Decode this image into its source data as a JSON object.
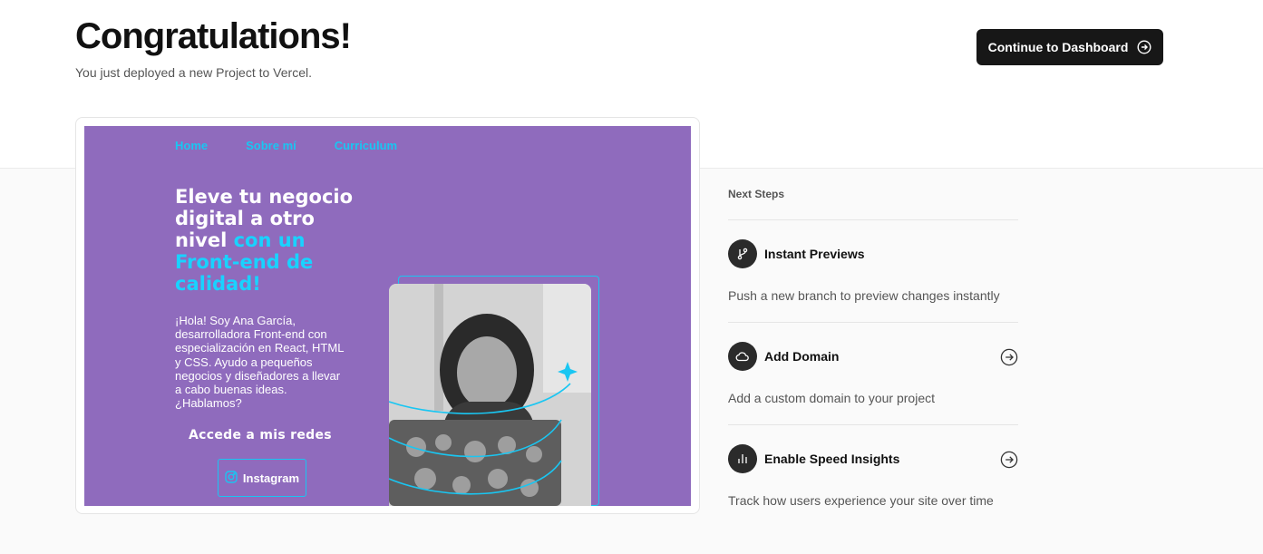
{
  "header": {
    "title": "Congratulations!",
    "subtitle": "You just deployed a new Project to Vercel.",
    "continue_label": "Continue to Dashboard"
  },
  "preview": {
    "nav": [
      "Home",
      "Sobre mí",
      "Curriculum"
    ],
    "headline_white": "Eleve tu negocio digital a otro nivel",
    "headline_accent": "con un Front-end de calidad!",
    "body": "¡Hola! Soy Ana García, desarrolladora Front-end con especialización en React, HTML y CSS. Ayudo a pequeños negocios y diseñadores a llevar a cabo buenas ideas. ¿Hablamos?",
    "redes": "Accede a mis redes",
    "instagram": "Instagram",
    "bg_color": "#8f6bbd",
    "accent_color": "#19d2ff"
  },
  "next_steps": {
    "heading": "Next Steps",
    "items": [
      {
        "title": "Instant Previews",
        "desc": "Push a new branch to preview changes instantly",
        "icon": "git-branch-icon"
      },
      {
        "title": "Add Domain",
        "desc": "Add a custom domain to your project",
        "icon": "cloud-icon"
      },
      {
        "title": "Enable Speed Insights",
        "desc": "Track how users experience your site over time",
        "icon": "bar-chart-icon"
      }
    ]
  }
}
